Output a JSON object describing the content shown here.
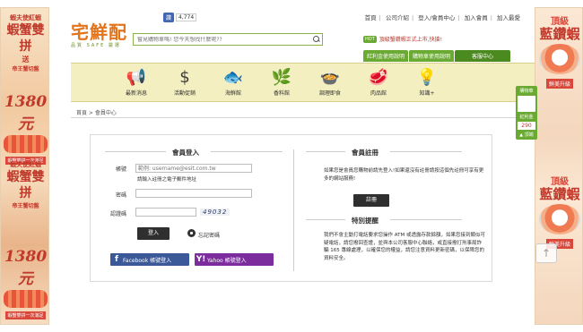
{
  "topbar": {
    "fb_like": "讚",
    "fb_count": "4,774",
    "links": [
      "首頁",
      "公司介紹",
      "登入/會員中心",
      "加入會員",
      "加入最愛"
    ]
  },
  "logo": {
    "name": "宅鮮配",
    "tagline": "品質 SAFE 嚴選"
  },
  "search": {
    "placeholder": "嘗見購物車嗎! 您今天想找什麼呢??"
  },
  "hot": {
    "badge": "HOT",
    "text": "頂級蟹鑽蝦正式上市,快搶!"
  },
  "top_tabs": [
    "紅利金使用說明",
    "購物車使用說明",
    "客服中心"
  ],
  "categories": [
    {
      "label": "最新消息",
      "icon": "megaphone-icon"
    },
    {
      "label": "活動促銷",
      "icon": "dollar-icon"
    },
    {
      "label": "海鮮館",
      "icon": "fish-icon"
    },
    {
      "label": "香料館",
      "icon": "herb-icon"
    },
    {
      "label": "調理即食",
      "icon": "pot-icon"
    },
    {
      "label": "肉品館",
      "icon": "meat-icon"
    },
    {
      "label": "知識+",
      "icon": "bulb-icon"
    }
  ],
  "breadcrumb": "首頁 > 會員中心",
  "login": {
    "title": "會員登入",
    "account_label": "帳號",
    "account_placeholder": "範例: username@esit.com.tw",
    "account_hint": "請輸入註冊之電子郵件地址",
    "password_label": "密碼",
    "captcha_label": "認證碼",
    "captcha_text": "49032",
    "login_button": "登入",
    "forgot_label": "忘記密碼",
    "facebook_button": "Facebook 帳號登入",
    "yahoo_button": "Yahoo 帳號登入"
  },
  "register": {
    "title": "會員註冊",
    "desc": "如果您是會員您購物前請先登入!如果還沒有註冊請按這個先註冊可享有更多的網站服務!",
    "button": "註冊"
  },
  "notice": {
    "title": "特別提醒",
    "desc": "我們不會主動打電話要求您操作 ATM 或透露存款餘額，如果您接到類似可疑電話，請您撥回查證，並與本公司客服中心聯絡，或直接撥打刑事局詐騙 165 專線處理，以確保您的權益，請您注意資料更新密碼，以保障您的資料安全。"
  },
  "left_banner": {
    "line1": "蝦夫使紅蝦",
    "free": "送",
    "gift": "帝王蟹切盤",
    "title": "蝦蟹雙拼",
    "price": "1380元",
    "tag": "蝦蟹雙拼一次滿足"
  },
  "right_banner": {
    "crown": "頂級",
    "title": "藍鑽蝦",
    "tag": "鮮美升級"
  },
  "float_panel": {
    "label": "購物車",
    "label2": "紅利金",
    "count": "290",
    "btn": "▲ 頂端"
  },
  "colors": {
    "accent_green": "#6aaa32",
    "brand_orange": "#e2751c",
    "category_bg": "#f3efc0",
    "facebook": "#3b5998",
    "yahoo": "#7b2d9e"
  }
}
